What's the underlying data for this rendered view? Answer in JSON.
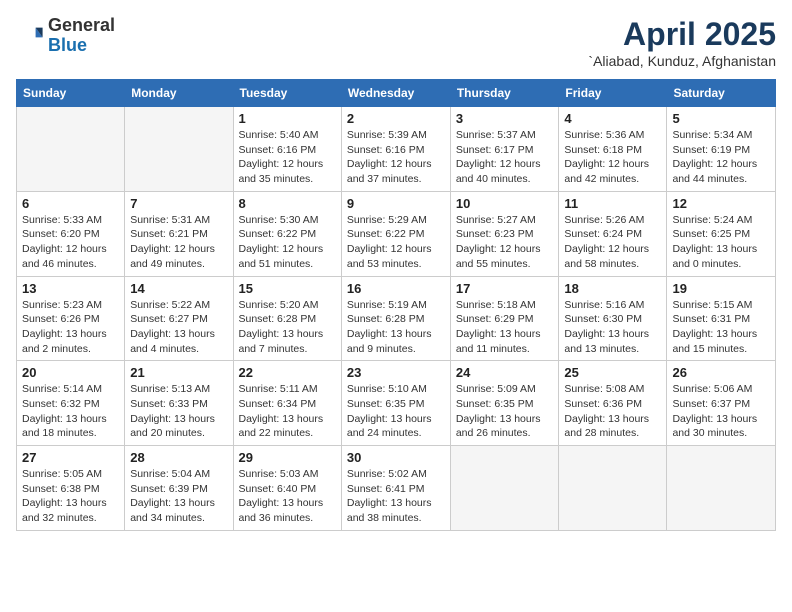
{
  "logo": {
    "general": "General",
    "blue": "Blue"
  },
  "header": {
    "month": "April 2025",
    "location": "`Aliabad, Kunduz, Afghanistan"
  },
  "days_of_week": [
    "Sunday",
    "Monday",
    "Tuesday",
    "Wednesday",
    "Thursday",
    "Friday",
    "Saturday"
  ],
  "weeks": [
    [
      {
        "day": "",
        "sunrise": "",
        "sunset": "",
        "daylight": ""
      },
      {
        "day": "",
        "sunrise": "",
        "sunset": "",
        "daylight": ""
      },
      {
        "day": "1",
        "sunrise": "Sunrise: 5:40 AM",
        "sunset": "Sunset: 6:16 PM",
        "daylight": "Daylight: 12 hours and 35 minutes."
      },
      {
        "day": "2",
        "sunrise": "Sunrise: 5:39 AM",
        "sunset": "Sunset: 6:16 PM",
        "daylight": "Daylight: 12 hours and 37 minutes."
      },
      {
        "day": "3",
        "sunrise": "Sunrise: 5:37 AM",
        "sunset": "Sunset: 6:17 PM",
        "daylight": "Daylight: 12 hours and 40 minutes."
      },
      {
        "day": "4",
        "sunrise": "Sunrise: 5:36 AM",
        "sunset": "Sunset: 6:18 PM",
        "daylight": "Daylight: 12 hours and 42 minutes."
      },
      {
        "day": "5",
        "sunrise": "Sunrise: 5:34 AM",
        "sunset": "Sunset: 6:19 PM",
        "daylight": "Daylight: 12 hours and 44 minutes."
      }
    ],
    [
      {
        "day": "6",
        "sunrise": "Sunrise: 5:33 AM",
        "sunset": "Sunset: 6:20 PM",
        "daylight": "Daylight: 12 hours and 46 minutes."
      },
      {
        "day": "7",
        "sunrise": "Sunrise: 5:31 AM",
        "sunset": "Sunset: 6:21 PM",
        "daylight": "Daylight: 12 hours and 49 minutes."
      },
      {
        "day": "8",
        "sunrise": "Sunrise: 5:30 AM",
        "sunset": "Sunset: 6:22 PM",
        "daylight": "Daylight: 12 hours and 51 minutes."
      },
      {
        "day": "9",
        "sunrise": "Sunrise: 5:29 AM",
        "sunset": "Sunset: 6:22 PM",
        "daylight": "Daylight: 12 hours and 53 minutes."
      },
      {
        "day": "10",
        "sunrise": "Sunrise: 5:27 AM",
        "sunset": "Sunset: 6:23 PM",
        "daylight": "Daylight: 12 hours and 55 minutes."
      },
      {
        "day": "11",
        "sunrise": "Sunrise: 5:26 AM",
        "sunset": "Sunset: 6:24 PM",
        "daylight": "Daylight: 12 hours and 58 minutes."
      },
      {
        "day": "12",
        "sunrise": "Sunrise: 5:24 AM",
        "sunset": "Sunset: 6:25 PM",
        "daylight": "Daylight: 13 hours and 0 minutes."
      }
    ],
    [
      {
        "day": "13",
        "sunrise": "Sunrise: 5:23 AM",
        "sunset": "Sunset: 6:26 PM",
        "daylight": "Daylight: 13 hours and 2 minutes."
      },
      {
        "day": "14",
        "sunrise": "Sunrise: 5:22 AM",
        "sunset": "Sunset: 6:27 PM",
        "daylight": "Daylight: 13 hours and 4 minutes."
      },
      {
        "day": "15",
        "sunrise": "Sunrise: 5:20 AM",
        "sunset": "Sunset: 6:28 PM",
        "daylight": "Daylight: 13 hours and 7 minutes."
      },
      {
        "day": "16",
        "sunrise": "Sunrise: 5:19 AM",
        "sunset": "Sunset: 6:28 PM",
        "daylight": "Daylight: 13 hours and 9 minutes."
      },
      {
        "day": "17",
        "sunrise": "Sunrise: 5:18 AM",
        "sunset": "Sunset: 6:29 PM",
        "daylight": "Daylight: 13 hours and 11 minutes."
      },
      {
        "day": "18",
        "sunrise": "Sunrise: 5:16 AM",
        "sunset": "Sunset: 6:30 PM",
        "daylight": "Daylight: 13 hours and 13 minutes."
      },
      {
        "day": "19",
        "sunrise": "Sunrise: 5:15 AM",
        "sunset": "Sunset: 6:31 PM",
        "daylight": "Daylight: 13 hours and 15 minutes."
      }
    ],
    [
      {
        "day": "20",
        "sunrise": "Sunrise: 5:14 AM",
        "sunset": "Sunset: 6:32 PM",
        "daylight": "Daylight: 13 hours and 18 minutes."
      },
      {
        "day": "21",
        "sunrise": "Sunrise: 5:13 AM",
        "sunset": "Sunset: 6:33 PM",
        "daylight": "Daylight: 13 hours and 20 minutes."
      },
      {
        "day": "22",
        "sunrise": "Sunrise: 5:11 AM",
        "sunset": "Sunset: 6:34 PM",
        "daylight": "Daylight: 13 hours and 22 minutes."
      },
      {
        "day": "23",
        "sunrise": "Sunrise: 5:10 AM",
        "sunset": "Sunset: 6:35 PM",
        "daylight": "Daylight: 13 hours and 24 minutes."
      },
      {
        "day": "24",
        "sunrise": "Sunrise: 5:09 AM",
        "sunset": "Sunset: 6:35 PM",
        "daylight": "Daylight: 13 hours and 26 minutes."
      },
      {
        "day": "25",
        "sunrise": "Sunrise: 5:08 AM",
        "sunset": "Sunset: 6:36 PM",
        "daylight": "Daylight: 13 hours and 28 minutes."
      },
      {
        "day": "26",
        "sunrise": "Sunrise: 5:06 AM",
        "sunset": "Sunset: 6:37 PM",
        "daylight": "Daylight: 13 hours and 30 minutes."
      }
    ],
    [
      {
        "day": "27",
        "sunrise": "Sunrise: 5:05 AM",
        "sunset": "Sunset: 6:38 PM",
        "daylight": "Daylight: 13 hours and 32 minutes."
      },
      {
        "day": "28",
        "sunrise": "Sunrise: 5:04 AM",
        "sunset": "Sunset: 6:39 PM",
        "daylight": "Daylight: 13 hours and 34 minutes."
      },
      {
        "day": "29",
        "sunrise": "Sunrise: 5:03 AM",
        "sunset": "Sunset: 6:40 PM",
        "daylight": "Daylight: 13 hours and 36 minutes."
      },
      {
        "day": "30",
        "sunrise": "Sunrise: 5:02 AM",
        "sunset": "Sunset: 6:41 PM",
        "daylight": "Daylight: 13 hours and 38 minutes."
      },
      {
        "day": "",
        "sunrise": "",
        "sunset": "",
        "daylight": ""
      },
      {
        "day": "",
        "sunrise": "",
        "sunset": "",
        "daylight": ""
      },
      {
        "day": "",
        "sunrise": "",
        "sunset": "",
        "daylight": ""
      }
    ]
  ]
}
